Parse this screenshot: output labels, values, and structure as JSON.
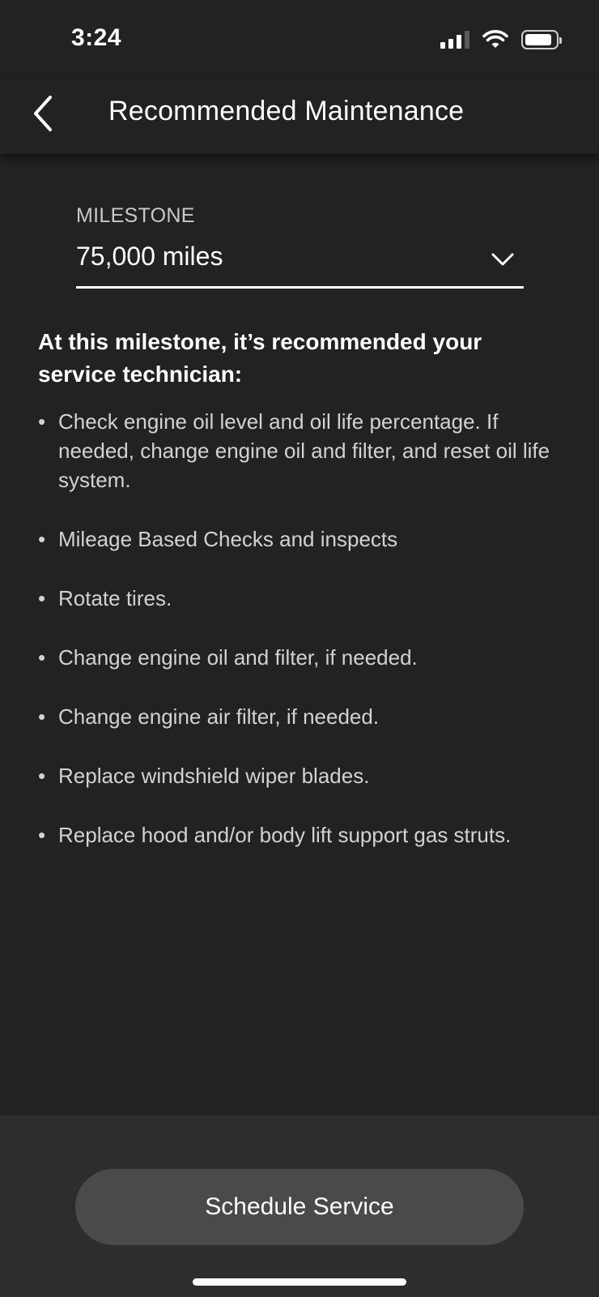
{
  "status_bar": {
    "time": "3:24",
    "icons": [
      "signal-icon",
      "wifi-icon",
      "battery-icon"
    ]
  },
  "header": {
    "title": "Recommended Maintenance",
    "back_icon": "chevron-left-icon"
  },
  "milestone": {
    "label": "MILESTONE",
    "value": "75,000 miles",
    "dropdown_icon": "chevron-down-icon"
  },
  "content": {
    "intro": "At this milestone, it’s recommended your service technician:",
    "bullet": "•",
    "tasks": [
      "Check engine oil level and oil life percentage. If needed, change engine oil and filter, and reset oil life system.",
      "Mileage Based Checks and inspects",
      "Rotate tires.",
      "Change engine oil and filter, if needed.",
      "Change engine air filter, if needed.",
      "Replace windshield wiper blades.",
      "Replace hood and/or body lift support gas struts."
    ]
  },
  "footer": {
    "button_label": "Schedule Service"
  },
  "colors": {
    "background": "#222222",
    "footer_background": "#2d2d2d",
    "button_background": "#4a4a4a",
    "text_primary": "#ffffff",
    "text_secondary": "#d2d2d2"
  }
}
